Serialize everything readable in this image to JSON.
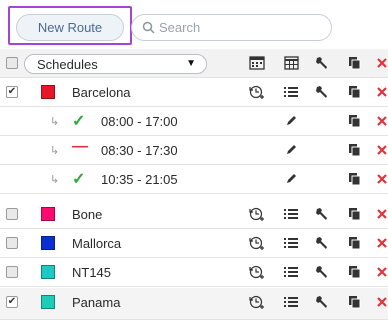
{
  "toolbar": {
    "new_route_label": "New Route",
    "search_placeholder": "Search"
  },
  "filter": {
    "selected": "Schedules"
  },
  "colors": {
    "check_green": "#2eaa3c",
    "dash_red": "#e0343a",
    "delete_red": "#e0343a",
    "highlight": "#a244d6"
  },
  "routes": [
    {
      "name": "Barcelona",
      "checked": true,
      "color": "#e8142a",
      "schedules": [
        {
          "status": "active",
          "time": "08:00 - 17:00"
        },
        {
          "status": "inactive",
          "time": "08:30 - 17:30"
        },
        {
          "status": "active",
          "time": "10:35 - 21:05"
        }
      ]
    },
    {
      "name": "Bone",
      "checked": false,
      "color": "#ff0a6e"
    },
    {
      "name": "Mallorca",
      "checked": false,
      "color": "#0a2fd4"
    },
    {
      "name": "NT145",
      "checked": false,
      "color": "#1ec8c3"
    },
    {
      "name": "Panama",
      "checked": true,
      "color": "#1dcdb7"
    }
  ]
}
